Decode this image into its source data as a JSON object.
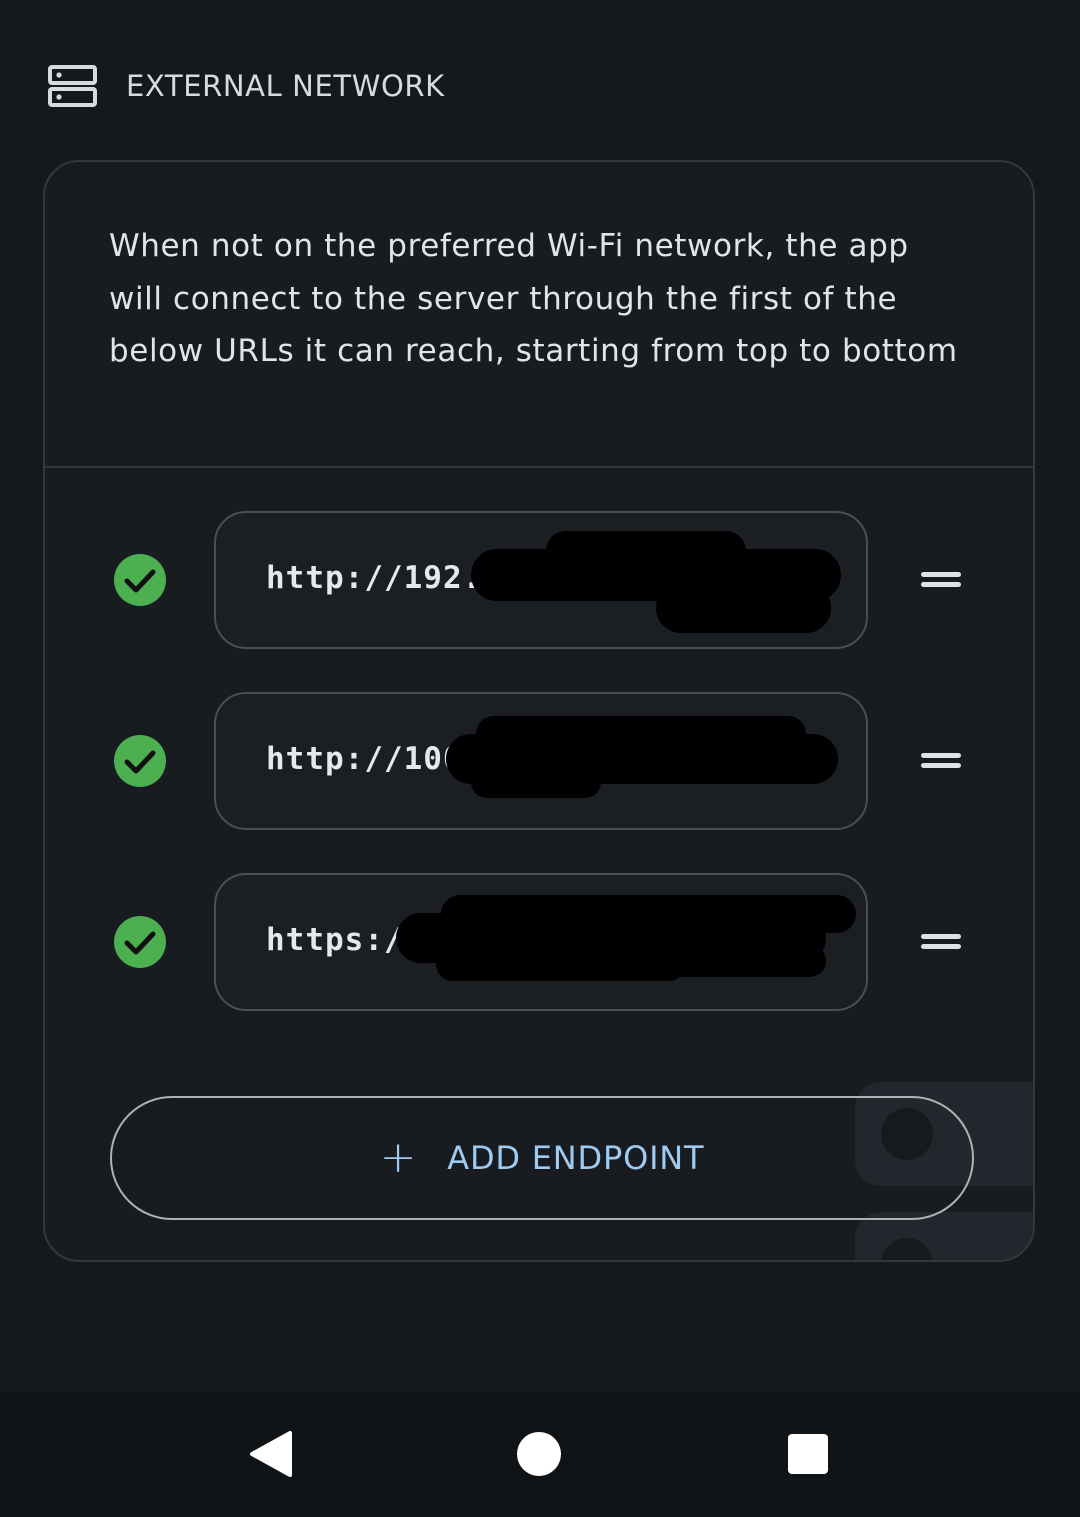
{
  "section": {
    "icon": "server-icon",
    "title": "EXTERNAL NETWORK"
  },
  "card": {
    "description": "When not on the preferred Wi-Fi network, the app will connect to the server through the first of the below URLs it can reach, starting from top to bottom"
  },
  "endpoints": [
    {
      "url_visible": "http://192.",
      "status": "reachable",
      "status_icon": "check-circle-icon",
      "handle_icon": "drag-handle-icon"
    },
    {
      "url_visible": "http://100",
      "status": "reachable",
      "status_icon": "check-circle-icon",
      "handle_icon": "drag-handle-icon"
    },
    {
      "url_visible": "https:/",
      "status": "reachable",
      "status_icon": "check-circle-icon",
      "handle_icon": "drag-handle-icon"
    }
  ],
  "add_button": {
    "icon": "plus-icon",
    "plus": "+",
    "label": "ADD ENDPOINT"
  },
  "navigation": {
    "back": "back-icon",
    "home": "home-icon",
    "recents": "recents-icon"
  },
  "colors": {
    "background": "#15191e",
    "card": "#181c20",
    "success": "#4cb050",
    "accent": "#9fcbf0"
  }
}
